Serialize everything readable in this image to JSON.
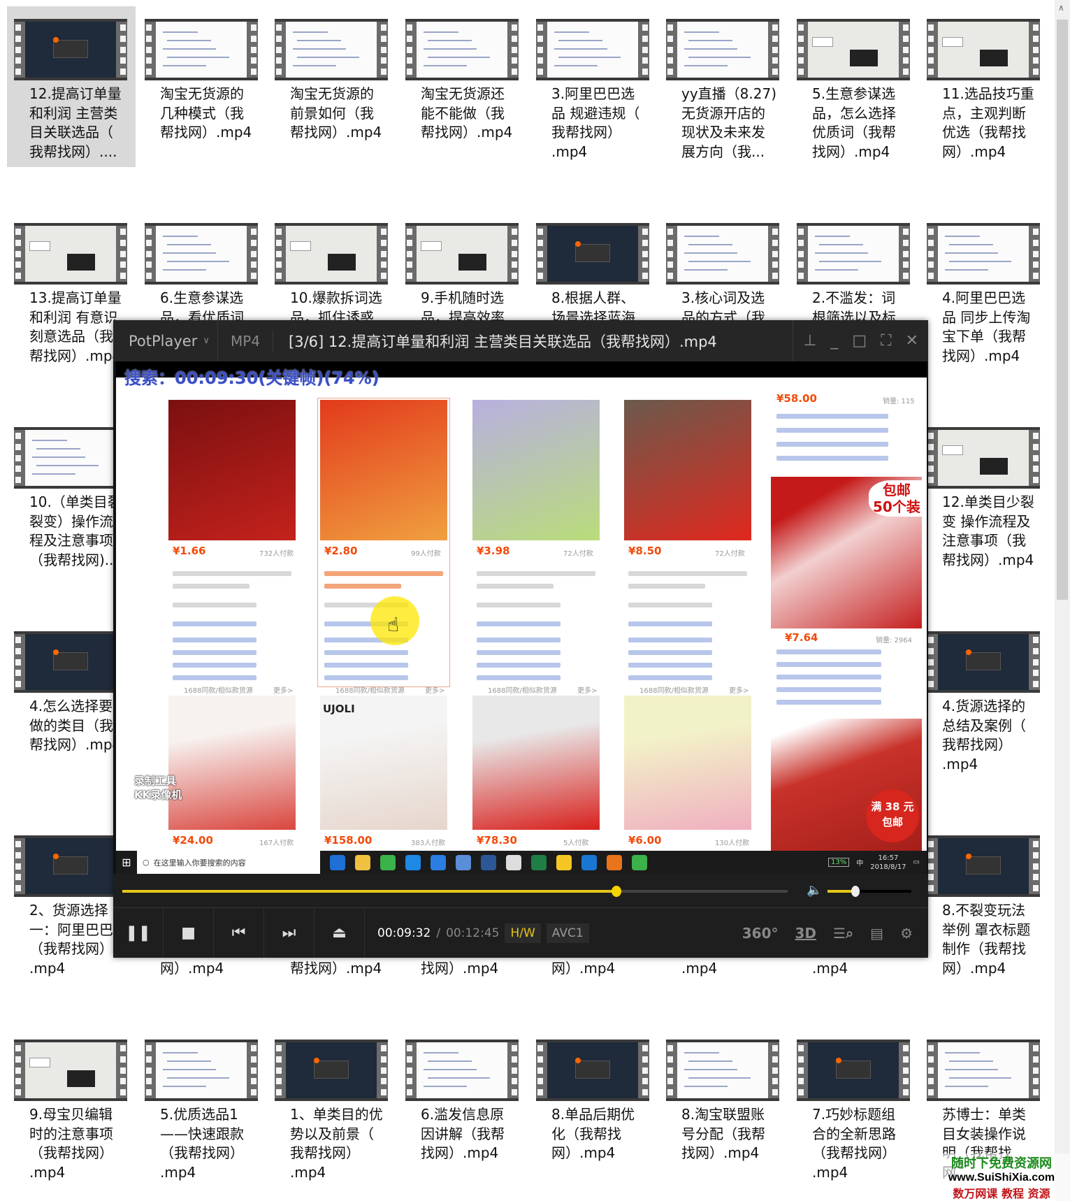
{
  "explorer": {
    "items": [
      {
        "label": "12.提高订单量\n和利润 主营类\n目关联选品（\n我帮找网）....",
        "theme": "dark",
        "selected": true
      },
      {
        "label": "淘宝无货源的\n几种模式（我\n帮找网）.mp4",
        "theme": "light"
      },
      {
        "label": "淘宝无货源的\n前景如何（我\n帮找网）.mp4",
        "theme": "light"
      },
      {
        "label": "淘宝无货源还\n能不能做（我\n帮找网）.mp4",
        "theme": "light"
      },
      {
        "label": "3.阿里巴巴选\n品 规避违规（\n我帮找网）\n.mp4",
        "theme": "light"
      },
      {
        "label": "yy直播（8.27)\n无货源开店的\n现状及未来发\n展方向（我...",
        "theme": "light"
      },
      {
        "label": "5.生意参谋选\n品，怎么选择\n优质词（我帮\n找网）.mp4",
        "theme": "gray"
      },
      {
        "label": "11.选品技巧重\n点，主观判断\n优选（我帮找\n网）.mp4",
        "theme": "gray"
      },
      {
        "label": "13.提高订单量\n和利润 有意识\n刻意选品（我\n帮找网）.mp4",
        "theme": "gray"
      },
      {
        "label": "6.生意参谋选\n品，看优质词",
        "theme": "light"
      },
      {
        "label": "10.爆款拆词选\n品，抓住诱惑",
        "theme": "gray"
      },
      {
        "label": "9.手机随时选\n品，提高效率",
        "theme": "gray"
      },
      {
        "label": "8.根据人群、\n场景选择蓝海",
        "theme": "dark"
      },
      {
        "label": "3.核心词及选\n品的方式（我",
        "theme": "light"
      },
      {
        "label": "2.不滥发：词\n根筛选以及标",
        "theme": "light"
      },
      {
        "label": "4.阿里巴巴选\n品 同步上传淘\n宝下单（我帮\n找网）.mp4",
        "theme": "light"
      },
      {
        "label": "10.（单类目裂\n裂变）操作流\n程及注意事项\n（我帮找网)...",
        "theme": "light"
      },
      {
        "label": "",
        "theme": "light"
      },
      {
        "label": "",
        "theme": "light"
      },
      {
        "label": "",
        "theme": "light"
      },
      {
        "label": "",
        "theme": "light"
      },
      {
        "label": "",
        "theme": "light"
      },
      {
        "label": "",
        "theme": "light"
      },
      {
        "label": "12.单类目少裂\n变 操作流程及\n注意事项（我\n帮找网）.mp4",
        "theme": "gray"
      },
      {
        "label": "4.怎么选择要\n做的类目（我\n帮找网）.mp4",
        "theme": "dark"
      },
      {
        "label": "",
        "theme": "dark"
      },
      {
        "label": "",
        "theme": "dark"
      },
      {
        "label": "",
        "theme": "dark"
      },
      {
        "label": "",
        "theme": "dark"
      },
      {
        "label": "",
        "theme": "dark"
      },
      {
        "label": "",
        "theme": "dark"
      },
      {
        "label": "4.货源选择的\n总结及案例（\n我帮找网）\n.mp4",
        "theme": "dark"
      },
      {
        "label": "2、货源选择\n一：阿里巴巴\n（我帮找网）\n.mp4",
        "theme": "dark"
      },
      {
        "label": "\n\n\n网）.mp4",
        "theme": "dark"
      },
      {
        "label": "\n\n\n帮找网）.mp4",
        "theme": "dark"
      },
      {
        "label": "\n\n\n找网）.mp4",
        "theme": "dark"
      },
      {
        "label": "\n\n\n网）.mp4",
        "theme": "dark"
      },
      {
        "label": "\n\n\n.mp4",
        "theme": "dark"
      },
      {
        "label": "\n\n\n.mp4",
        "theme": "dark"
      },
      {
        "label": "8.不裂变玩法\n举例 罩衣标题\n制作（我帮找\n网）.mp4",
        "theme": "dark"
      },
      {
        "label": "9.母宝贝编辑\n时的注意事项\n（我帮找网）\n.mp4",
        "theme": "gray"
      },
      {
        "label": "5.优质选品1\n——快速跟款\n（我帮找网）\n.mp4",
        "theme": "light"
      },
      {
        "label": "1、单类目的优\n势以及前景（\n我帮找网）\n.mp4",
        "theme": "dark"
      },
      {
        "label": "6.滥发信息原\n因讲解（我帮\n找网）.mp4",
        "theme": "light"
      },
      {
        "label": "8.单品后期优\n化（我帮找\n网）.mp4",
        "theme": "dark"
      },
      {
        "label": "8.淘宝联盟账\n号分配（我帮\n找网）.mp4",
        "theme": "light"
      },
      {
        "label": "7.巧妙标题组\n合的全新思路\n（我帮找网）\n.mp4",
        "theme": "dark"
      },
      {
        "label": "苏博士：单类\n目女装操作说\n明（我帮找\n网",
        "theme": "light"
      }
    ]
  },
  "watermark": {
    "line1": "随时下免费资源网",
    "line2": "www.SuiShiXia.com",
    "line3": "数万网课 教程 资源"
  },
  "player": {
    "brand": "PotPlayer",
    "format": "MP4",
    "title": "[3/6] 12.提高订单量和利润 主营类目关联选品（我帮找网）.mp4",
    "osd": "搜索：00:09:30(关键帧)(74%)",
    "progress_percent": 74.3,
    "volume_percent": 33,
    "current_time": "00:09:32",
    "separator": "/",
    "total_time": "00:12:45",
    "hw_label": "H/W",
    "codec": "AVC1",
    "accent": "#e6c619"
  },
  "video": {
    "recorder_watermark": "录制工具\nKK录像机",
    "row1": [
      {
        "price": "¥1.66",
        "sales": "732人付款",
        "img": [
          "#7a1010",
          "#c4221c"
        ]
      },
      {
        "price": "¥2.80",
        "sales": "99人付款",
        "img": [
          "#e23a1c",
          "#f0a040"
        ]
      },
      {
        "price": "¥3.98",
        "sales": "72人付款",
        "img": [
          "#b8b0e0",
          "#b9dc7a"
        ]
      },
      {
        "price": "¥8.50",
        "sales": "72人付款",
        "img": [
          "#6b5a4c",
          "#e0281e"
        ]
      }
    ],
    "row2_header": "1688同款/相似款货源",
    "row2_more": "更多>",
    "row2": [
      {
        "price": "¥24.00",
        "sales": "167人付款",
        "img": [
          "#f7f2f0",
          "#d9463e"
        ]
      },
      {
        "price": "¥158.00",
        "sales": "383人付款",
        "img": [
          "#f4f4f4",
          "#e6d6cc"
        ],
        "brand": "UJOLI"
      },
      {
        "price": "¥78.30",
        "sales": "5人付款",
        "img": [
          "#e8e8e8",
          "#d8201c"
        ]
      },
      {
        "price": "¥6.00",
        "sales": "130人付款",
        "img": [
          "#f2f2c8",
          "#f0b0c0"
        ]
      }
    ],
    "side": {
      "price1": "¥58.00",
      "sales1": "销量: 115",
      "banner": "包邮\n50个装",
      "price2": "¥7.64",
      "sales2": "销量: 2964",
      "promo": "满 38 元\n包邮"
    },
    "taskbar": {
      "search_placeholder": "在这里输入你要搜索的内容",
      "battery": "13%",
      "ime": "中",
      "time": "16:57",
      "date": "2018/8/17"
    }
  }
}
